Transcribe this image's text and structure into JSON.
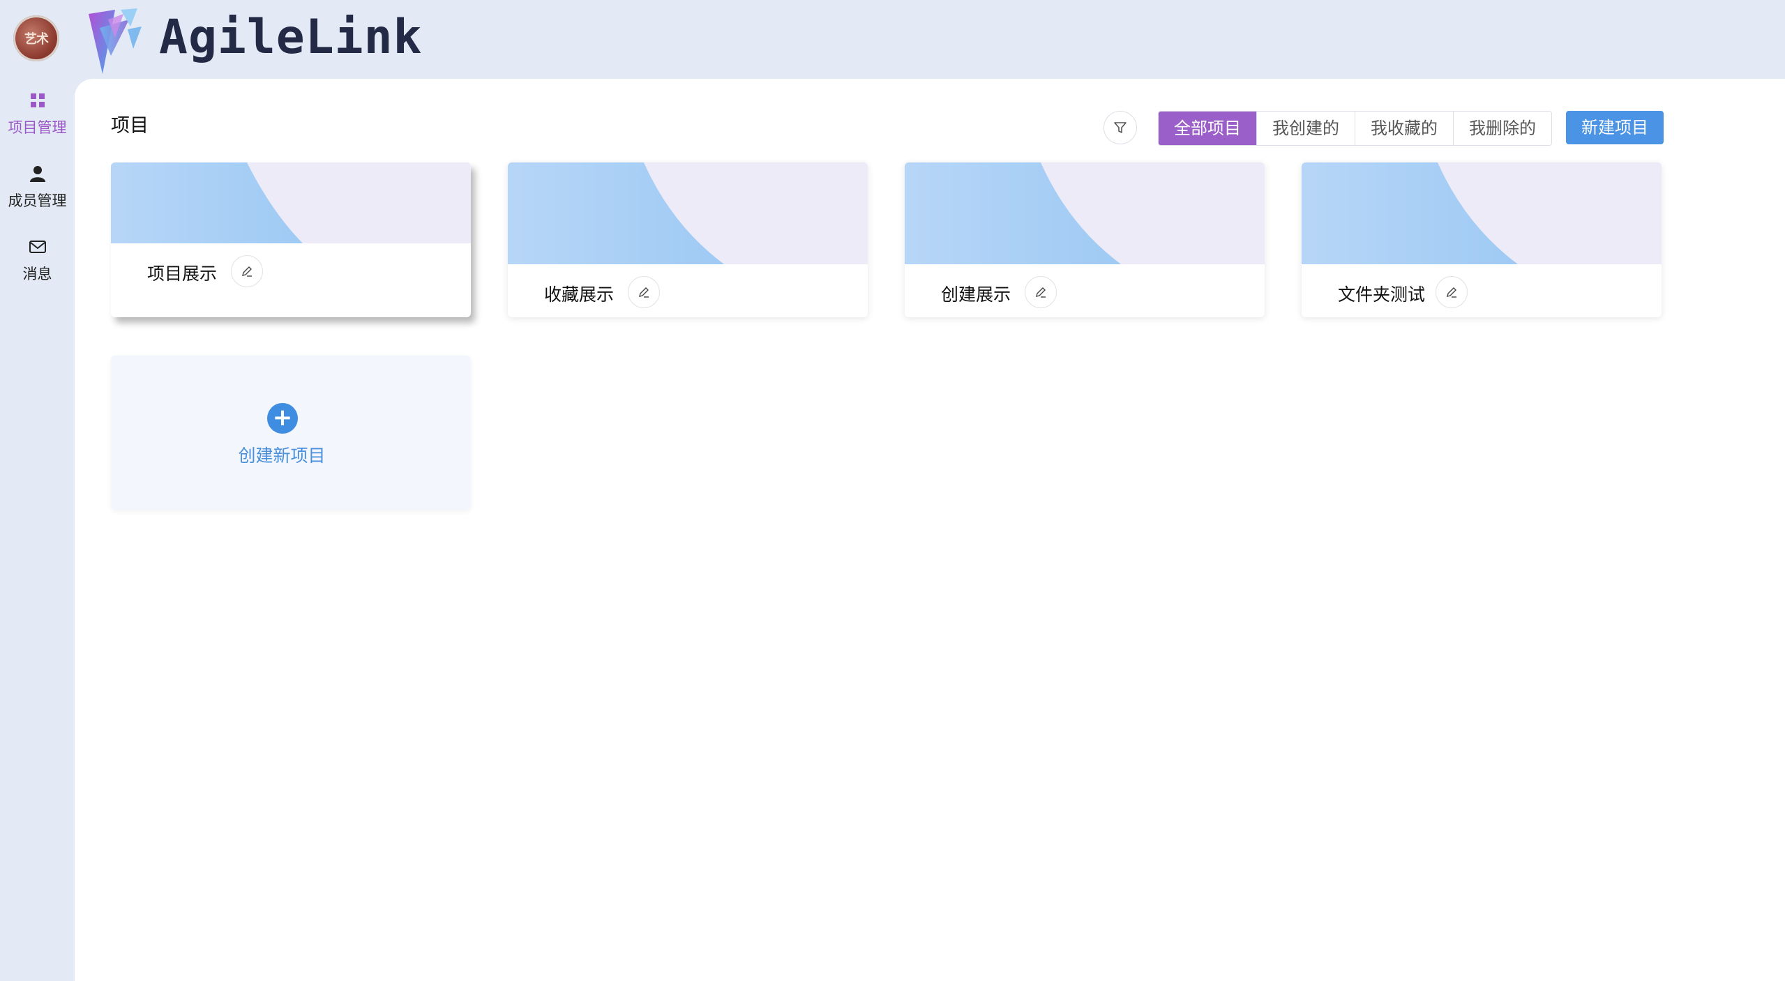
{
  "app": {
    "brand_name": "AgileLink",
    "avatar_text": "艺术",
    "accent_color": "#9b5fc9",
    "primary_color": "#4a93e5"
  },
  "sidebar": {
    "items": [
      {
        "label": "项目管理",
        "icon": "grid-icon",
        "active": true
      },
      {
        "label": "成员管理",
        "icon": "user-icon",
        "active": false
      },
      {
        "label": "消息",
        "icon": "mail-icon",
        "active": false
      }
    ]
  },
  "main": {
    "title": "项目",
    "filter_icon": "filter-icon",
    "tabs": [
      {
        "label": "全部项目",
        "active": true
      },
      {
        "label": "我创建的",
        "active": false
      },
      {
        "label": "我收藏的",
        "active": false
      },
      {
        "label": "我删除的",
        "active": false
      }
    ],
    "new_project_label": "新建项目",
    "projects": [
      {
        "name": "项目展示",
        "hovered": true
      },
      {
        "name": "收藏展示",
        "hovered": false
      },
      {
        "name": "创建展示",
        "hovered": false
      },
      {
        "name": "文件夹测试",
        "hovered": false
      }
    ],
    "create_new_label": "创建新项目"
  }
}
